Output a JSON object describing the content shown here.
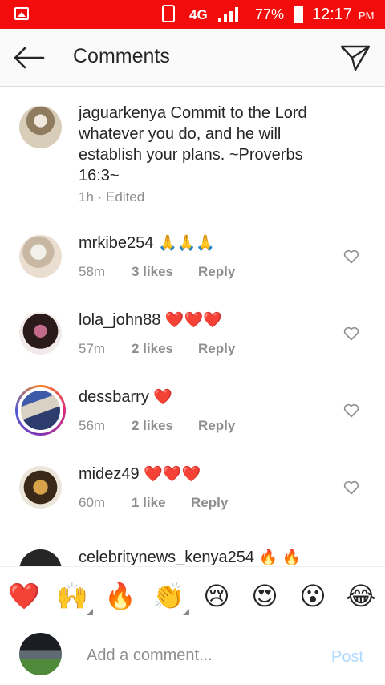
{
  "status_bar": {
    "network": "4G",
    "battery": "77%",
    "time": "12:17",
    "ampm": "PM",
    "bg_color": "#f20c0c"
  },
  "header": {
    "title": "Comments",
    "back_icon": "arrow-left-icon",
    "send_icon": "paper-plane-icon"
  },
  "caption": {
    "username": "jaguarkenya",
    "text": "Commit to the Lord whatever you do, and he will establish your plans. ~Proverbs 16:3~",
    "meta": "1h · Edited"
  },
  "comments": [
    {
      "username": "mrkibe254",
      "emoji": "🙏🙏🙏",
      "time": "58m",
      "likes": "3 likes",
      "reply": "Reply"
    },
    {
      "username": "lola_john88",
      "emoji": "❤️❤️❤️",
      "time": "57m",
      "likes": "2 likes",
      "reply": "Reply"
    },
    {
      "username": "dessbarry",
      "emoji": "❤️",
      "time": "56m",
      "likes": "2 likes",
      "reply": "Reply"
    },
    {
      "username": "midez49",
      "emoji": "❤️❤️❤️",
      "time": "60m",
      "likes": "1 like",
      "reply": "Reply"
    },
    {
      "username": "celebritynews_kenya254",
      "emoji": "🔥 🔥",
      "time": "",
      "likes": "",
      "reply": ""
    }
  ],
  "emoji_bar": [
    "❤️",
    "🙌",
    "🔥",
    "👏",
    "😢",
    "😍",
    "😮",
    "😂"
  ],
  "compose": {
    "placeholder": "Add a comment...",
    "post_label": "Post",
    "post_color": "#b3dbff"
  }
}
